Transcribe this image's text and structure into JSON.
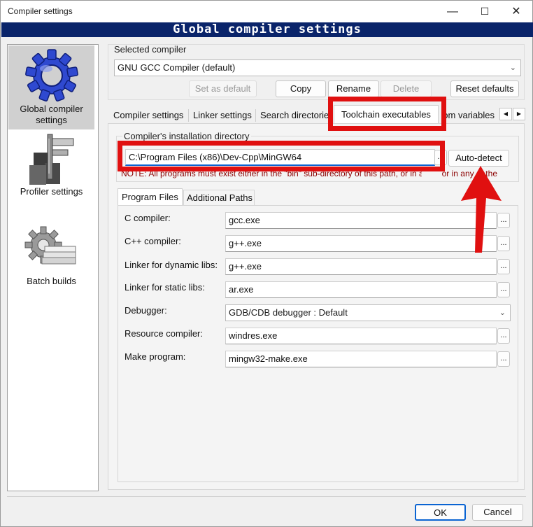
{
  "window": {
    "title": "Compiler settings",
    "minimize": "—",
    "maximize": "☐",
    "close": "✕"
  },
  "banner": "Global compiler settings",
  "sidebar": {
    "items": [
      {
        "label": "Global compiler settings",
        "icon": "gear-icon",
        "selected": true
      },
      {
        "label": "Profiler settings",
        "icon": "caliper-icon",
        "selected": false
      },
      {
        "label": "Batch builds",
        "icon": "gear-stack-icon",
        "selected": false
      }
    ]
  },
  "compiler": {
    "group_label": "Selected compiler",
    "selected": "GNU GCC Compiler (default)",
    "buttons": {
      "set_default": "Set as default",
      "copy": "Copy",
      "rename": "Rename",
      "delete": "Delete",
      "reset": "Reset defaults"
    }
  },
  "tabs": [
    "Compiler settings",
    "Linker settings",
    "Search directories",
    "Toolchain executables",
    "Custom variables"
  ],
  "active_tab": "Toolchain executables",
  "install_dir": {
    "group_label": "Compiler's installation directory",
    "value": "C:\\Program Files (x86)\\Dev-Cpp\\MinGW64",
    "browse": "...",
    "auto_detect": "Auto-detect",
    "note": "NOTE: All programs must exist either in the \"bin\" sub-directory of this path, or in any of the"
  },
  "subtabs": [
    "Program Files",
    "Additional Paths"
  ],
  "programs": [
    {
      "label": "C compiler:",
      "value": "gcc.exe",
      "type": "text"
    },
    {
      "label": "C++ compiler:",
      "value": "g++.exe",
      "type": "text"
    },
    {
      "label": "Linker for dynamic libs:",
      "value": "g++.exe",
      "type": "text"
    },
    {
      "label": "Linker for static libs:",
      "value": "ar.exe",
      "type": "text"
    },
    {
      "label": "Debugger:",
      "value": "GDB/CDB debugger : Default",
      "type": "select"
    },
    {
      "label": "Resource compiler:",
      "value": "windres.exe",
      "type": "text"
    },
    {
      "label": "Make program:",
      "value": "mingw32-make.exe",
      "type": "text"
    }
  ],
  "footer": {
    "ok": "OK",
    "cancel": "Cancel"
  },
  "colors": {
    "banner_bg": "#0a246a",
    "highlight": "#e01010",
    "accent": "#0a64d2"
  }
}
